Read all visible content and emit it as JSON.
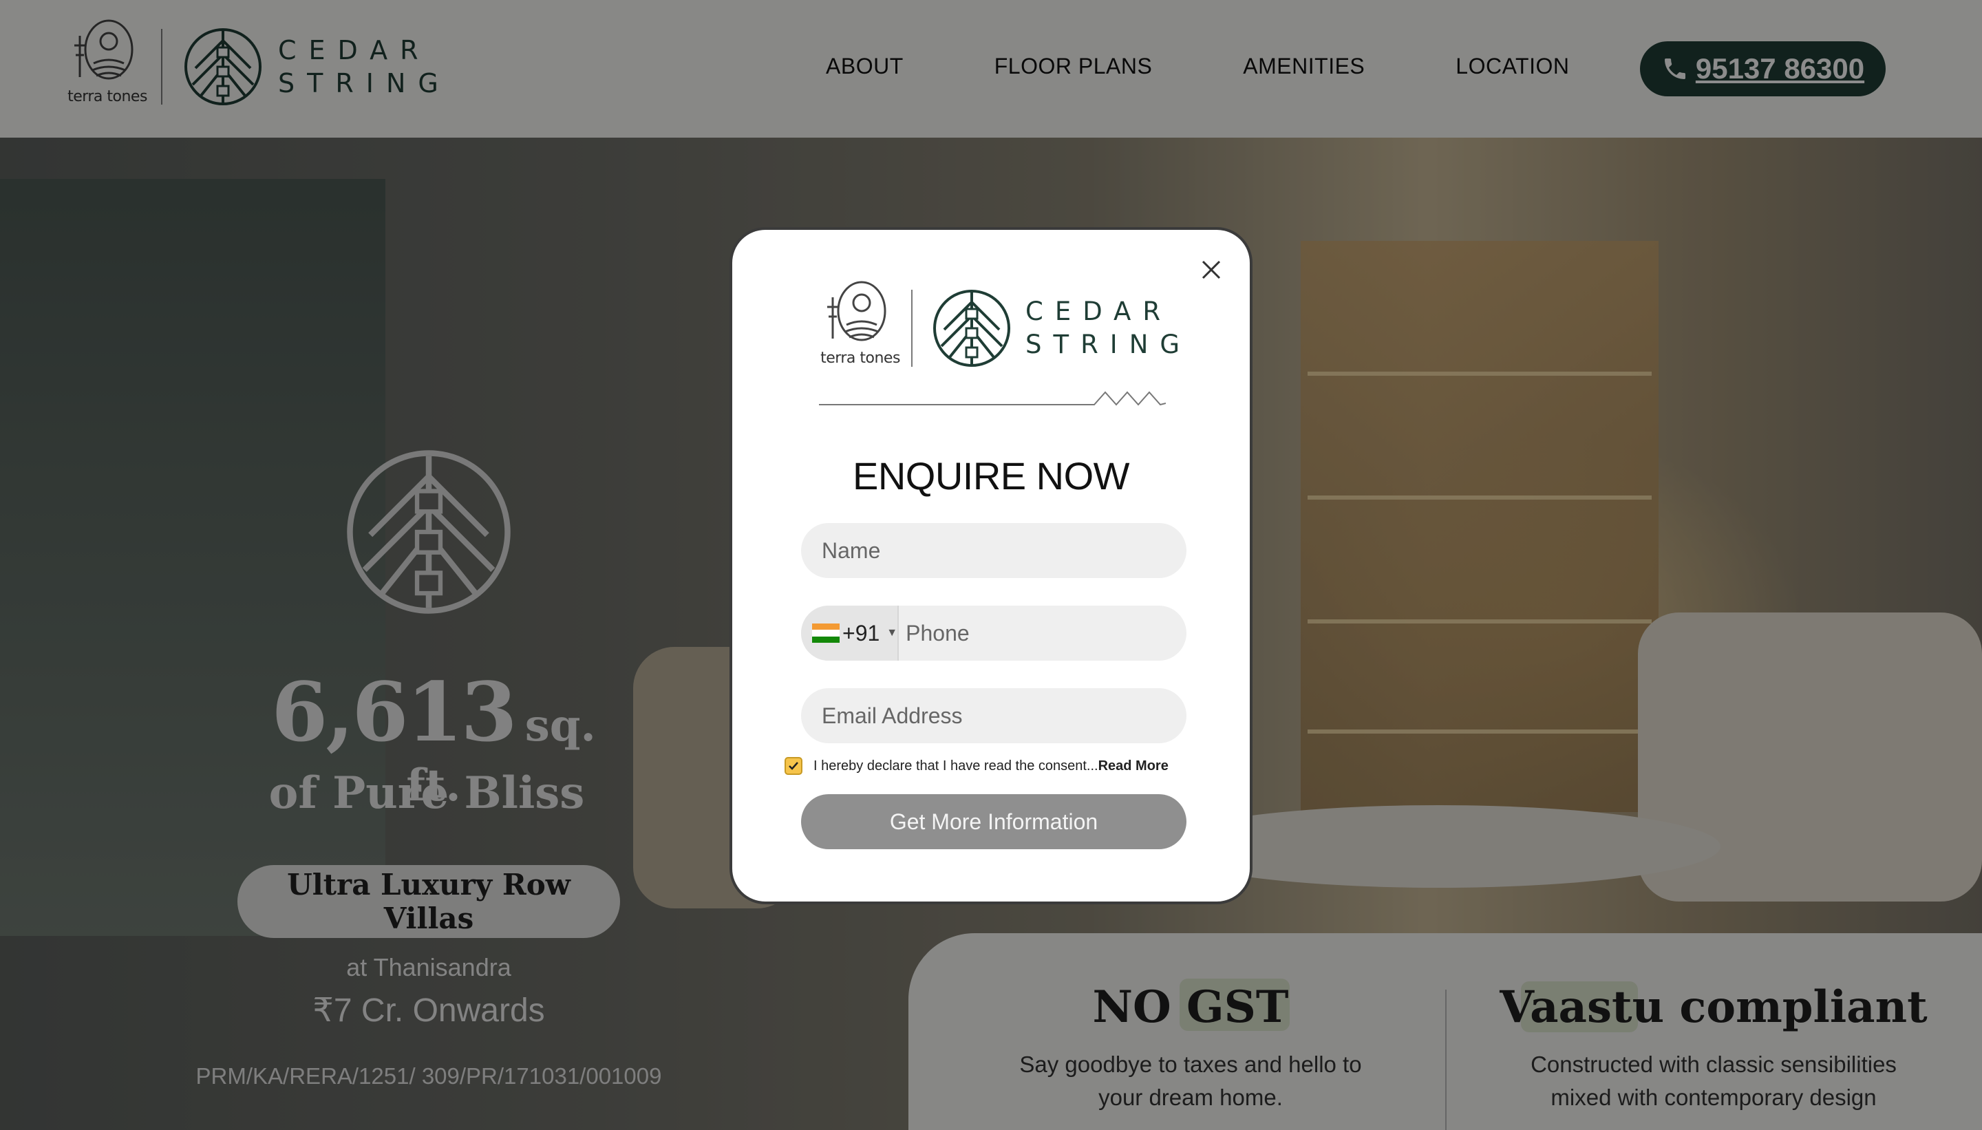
{
  "header": {
    "logo_terra": "terra tones",
    "logo_cedar_line1": "CEDAR",
    "logo_cedar_line2": "STRING",
    "nav": [
      "ABOUT",
      "FLOOR PLANS",
      "AMENITIES",
      "LOCATION"
    ],
    "phone": "95137 86300"
  },
  "hero": {
    "area_value": "6,613",
    "area_unit": "sq. ft.",
    "tagline": "of Pure Bliss",
    "pill_label": "Ultra Luxury Row Villas",
    "location": "at Thanisandra",
    "price": "₹7 Cr. Onwards",
    "rera": "PRM/KA/RERA/1251/ 309/PR/171031/001009"
  },
  "features": [
    {
      "title": "NO GST",
      "text_line1": "Say goodbye to taxes and hello to",
      "text_line2": "your dream home."
    },
    {
      "title": "Vaastu compliant",
      "text_line1": "Constructed with classic sensibilities",
      "text_line2": "mixed with contemporary design"
    }
  ],
  "modal": {
    "logo_terra": "terra tones",
    "logo_cedar_line1": "CEDAR",
    "logo_cedar_line2": "STRING",
    "title": "ENQUIRE NOW",
    "name_placeholder": "Name",
    "country_code": "+91",
    "phone_placeholder": "Phone",
    "email_placeholder": "Email Address",
    "consent_text": "I hereby declare that I have read the consent...",
    "consent_link": "Read More",
    "consent_checked": true,
    "submit_label": "Get More Information"
  },
  "colors": {
    "brand_green": "#1f3d35",
    "checkbox": "#f6c44b",
    "submit_bg": "#8f8f8f"
  },
  "icons": {
    "close": "close-icon",
    "phone": "phone-icon",
    "flag": "india-flag-icon"
  }
}
